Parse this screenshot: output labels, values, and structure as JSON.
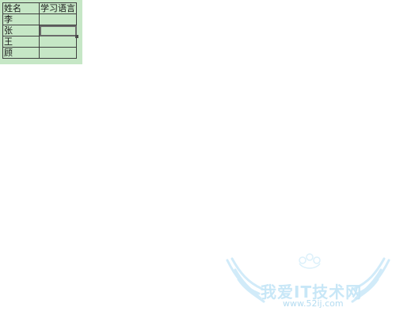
{
  "spreadsheet": {
    "columns": [
      "姓名",
      "学习语言"
    ],
    "rows": [
      {
        "name": "李",
        "language": ""
      },
      {
        "name": "张",
        "language": ""
      },
      {
        "name": "王",
        "language": ""
      },
      {
        "name": "顾",
        "language": ""
      }
    ],
    "selected_cell": {
      "row": 1,
      "column": 1
    }
  },
  "watermark": {
    "title": "我爱IT技术网",
    "url": "www.52ij.com",
    "color": "#bfe3f6"
  },
  "colors": {
    "sheet_background": "#c6e7c6",
    "grid_line": "#3f3f3f"
  }
}
